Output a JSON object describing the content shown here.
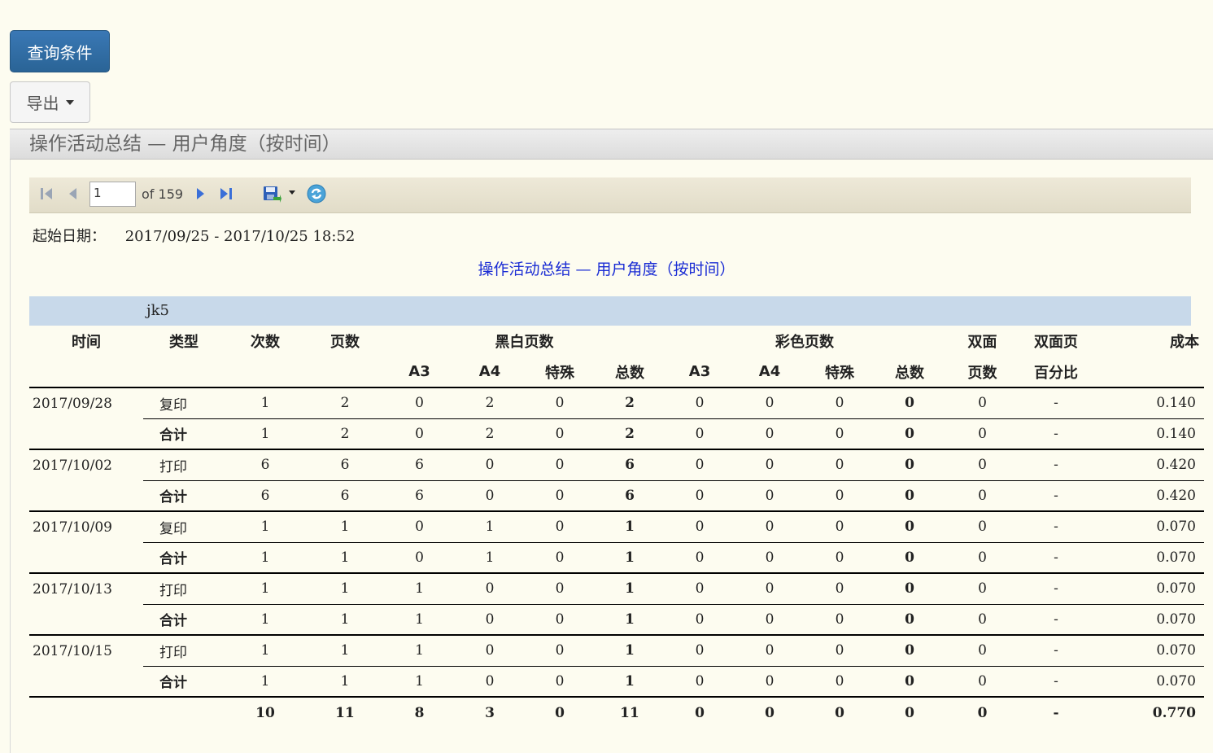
{
  "buttons": {
    "query_label": "查询条件",
    "export_label": "导出"
  },
  "panel": {
    "title": "操作活动总结 — 用户角度（按时间）"
  },
  "toolbar": {
    "page_value": "1",
    "of_text": "of 159"
  },
  "filter": {
    "label": "起始日期：",
    "value": "2017/09/25 - 2017/10/25 18:52"
  },
  "report": {
    "title": "操作活动总结 — 用户角度（按时间）",
    "user": "jk5",
    "headers": {
      "time": "时间",
      "type": "类型",
      "count": "次数",
      "pages": "页数",
      "bw": "黑白页数",
      "color": "彩色页数",
      "duplex": "双面",
      "duplex_pct": "双面页",
      "cost": "成本",
      "a3": "A3",
      "a4": "A4",
      "special": "特殊",
      "total": "总数",
      "duplex2": "页数",
      "duplex_pct2": "百分比"
    },
    "groups": [
      {
        "date": "2017/09/28",
        "rows": [
          [
            "复印",
            "1",
            "2",
            "0",
            "2",
            "0",
            "2",
            "0",
            "0",
            "0",
            "0",
            "0",
            "-",
            "0.140"
          ],
          [
            "合计",
            "1",
            "2",
            "0",
            "2",
            "0",
            "2",
            "0",
            "0",
            "0",
            "0",
            "0",
            "-",
            "0.140"
          ]
        ]
      },
      {
        "date": "2017/10/02",
        "rows": [
          [
            "打印",
            "6",
            "6",
            "6",
            "0",
            "0",
            "6",
            "0",
            "0",
            "0",
            "0",
            "0",
            "-",
            "0.420"
          ],
          [
            "合计",
            "6",
            "6",
            "6",
            "0",
            "0",
            "6",
            "0",
            "0",
            "0",
            "0",
            "0",
            "-",
            "0.420"
          ]
        ]
      },
      {
        "date": "2017/10/09",
        "rows": [
          [
            "复印",
            "1",
            "1",
            "0",
            "1",
            "0",
            "1",
            "0",
            "0",
            "0",
            "0",
            "0",
            "-",
            "0.070"
          ],
          [
            "合计",
            "1",
            "1",
            "0",
            "1",
            "0",
            "1",
            "0",
            "0",
            "0",
            "0",
            "0",
            "-",
            "0.070"
          ]
        ]
      },
      {
        "date": "2017/10/13",
        "rows": [
          [
            "打印",
            "1",
            "1",
            "1",
            "0",
            "0",
            "1",
            "0",
            "0",
            "0",
            "0",
            "0",
            "-",
            "0.070"
          ],
          [
            "合计",
            "1",
            "1",
            "1",
            "0",
            "0",
            "1",
            "0",
            "0",
            "0",
            "0",
            "0",
            "-",
            "0.070"
          ]
        ]
      },
      {
        "date": "2017/10/15",
        "rows": [
          [
            "打印",
            "1",
            "1",
            "1",
            "0",
            "0",
            "1",
            "0",
            "0",
            "0",
            "0",
            "0",
            "-",
            "0.070"
          ],
          [
            "合计",
            "1",
            "1",
            "1",
            "0",
            "0",
            "1",
            "0",
            "0",
            "0",
            "0",
            "0",
            "-",
            "0.070"
          ]
        ]
      }
    ],
    "totals": [
      "10",
      "11",
      "8",
      "3",
      "0",
      "11",
      "0",
      "0",
      "0",
      "0",
      "0",
      "-",
      "0.770"
    ]
  },
  "colors": {
    "primary_button": "#2a6496",
    "title_link": "#1a2cd4",
    "user_band": "#c8d9ea",
    "page_bg": "#fdfcf0"
  },
  "icons": [
    "first-page-icon",
    "prev-page-icon",
    "next-page-icon",
    "last-page-icon",
    "save-export-icon",
    "dropdown-caret-icon",
    "refresh-icon"
  ]
}
